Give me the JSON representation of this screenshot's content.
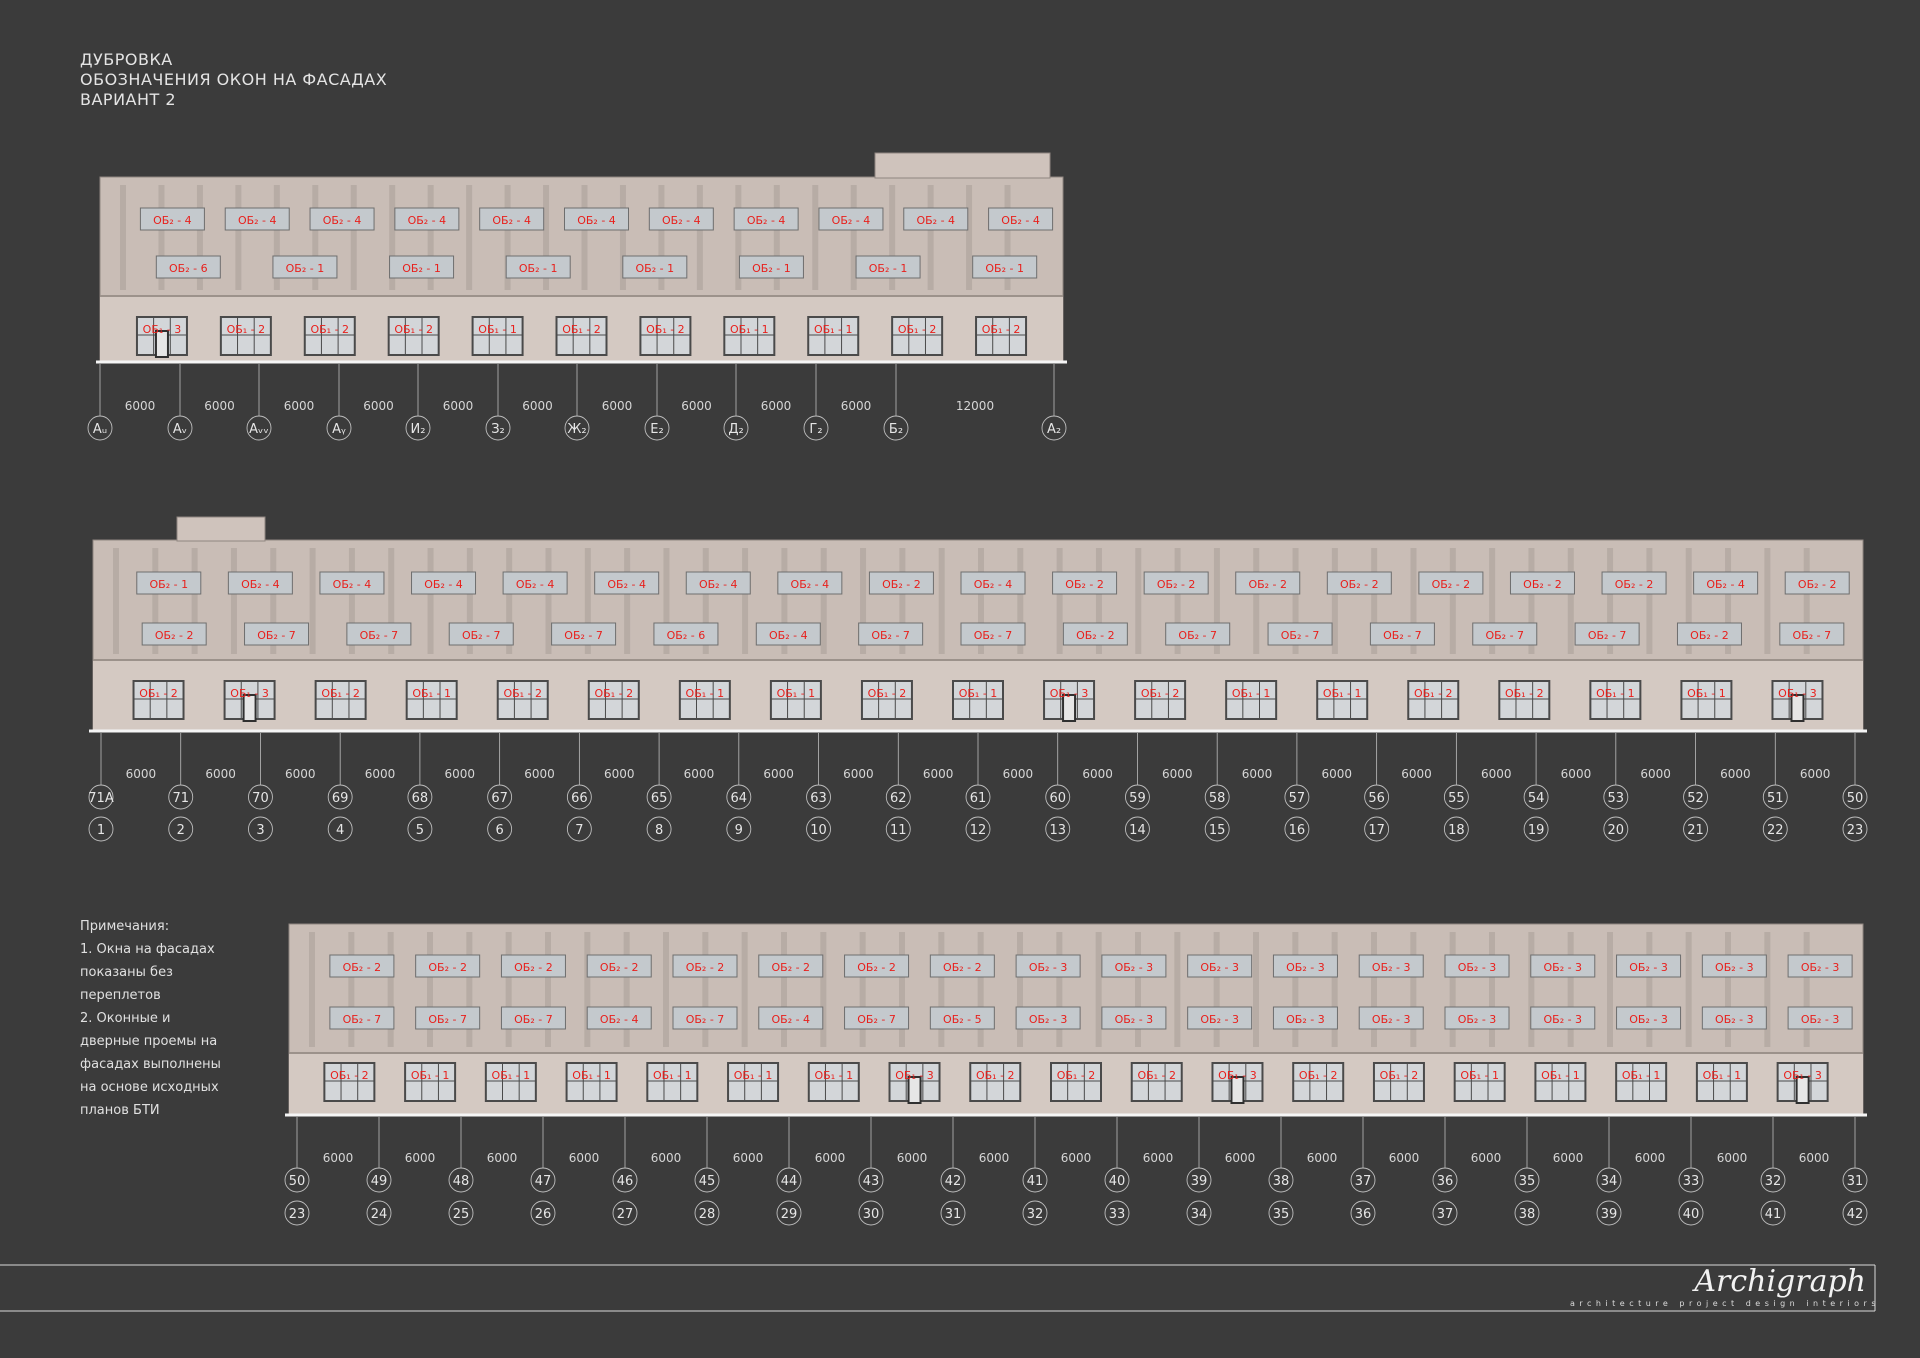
{
  "title": {
    "line1": "ДУБРОВКА",
    "line2": "ОБОЗНАЧЕНИЯ ОКОН НА ФАСАДАХ",
    "line3": "ВАРИАНТ 2"
  },
  "notes": {
    "heading": "Примечания:",
    "lines": [
      "1. Окна на фасадах",
      "показаны без",
      "переплетов",
      "2. Оконные и",
      "дверные проемы на",
      "фасадах выполнены",
      "на основе исходных",
      "планов БТИ"
    ]
  },
  "brand": {
    "signature": "Archigraph",
    "tagline": "architecture project design interiors"
  },
  "colors": {
    "background": "#3b3b3b",
    "facade": "#c9bdb6",
    "window": "#c4c9cd",
    "label": "#e8201c",
    "axis": "#bdbdbd"
  },
  "facades": [
    {
      "name": "facade-1",
      "dims": [
        "6000",
        "6000",
        "6000",
        "6000",
        "6000",
        "6000",
        "6000",
        "6000",
        "6000",
        "6000",
        "12000"
      ],
      "axes": [
        "Аᵤ",
        "Аᵥ",
        "Аᵥᵥ",
        "Аᵧ",
        "И₂",
        "З₂",
        "Ж₂",
        "Е₂",
        "Д₂",
        "Г₂",
        "Б₂",
        "А₂"
      ],
      "axes2": [],
      "row1": [
        "ОБ₂ - 4",
        "ОБ₂ - 4",
        "ОБ₂ - 4",
        "ОБ₂ - 4",
        "ОБ₂ - 4",
        "ОБ₂ - 4",
        "ОБ₂ - 4",
        "ОБ₂ - 4",
        "ОБ₂ - 4",
        "ОБ₂ - 4",
        "ОБ₂ - 4"
      ],
      "row2": [
        "ОБ₂ - 6",
        "ОБ₂ - 1",
        "ОБ₂ - 1",
        "ОБ₂ - 1",
        "ОБ₂ - 1",
        "ОБ₂ - 1",
        "ОБ₂ - 1",
        "ОБ₂ - 1"
      ],
      "ground": [
        "ОБ₁ - 3",
        "ОБ₁ - 2",
        "ОБ₁ - 2",
        "ОБ₁ - 2",
        "ОБ₁ - 1",
        "ОБ₁ - 2",
        "ОБ₁ - 2",
        "ОБ₁ - 1",
        "ОБ₁ - 1",
        "ОБ₁ - 2",
        "ОБ₁ - 2"
      ]
    },
    {
      "name": "facade-2",
      "dims": [
        "6000",
        "6000",
        "6000",
        "6000",
        "6000",
        "6000",
        "6000",
        "6000",
        "6000",
        "6000",
        "6000",
        "6000",
        "6000",
        "6000",
        "6000",
        "6000",
        "6000",
        "6000",
        "6000",
        "6000",
        "6000",
        "6000"
      ],
      "axes": [
        "71А",
        "71",
        "70",
        "69",
        "68",
        "67",
        "66",
        "65",
        "64",
        "63",
        "62",
        "61",
        "60",
        "59",
        "58",
        "57",
        "56",
        "55",
        "54",
        "53",
        "52",
        "51",
        "50"
      ],
      "axes2": [
        "1",
        "2",
        "3",
        "4",
        "5",
        "6",
        "7",
        "8",
        "9",
        "10",
        "11",
        "12",
        "13",
        "14",
        "15",
        "16",
        "17",
        "18",
        "19",
        "20",
        "21",
        "22",
        "23"
      ],
      "row1": [
        "ОБ₂ - 1",
        "ОБ₂ - 4",
        "ОБ₂ - 4",
        "ОБ₂ - 4",
        "ОБ₂ - 4",
        "ОБ₂ - 4",
        "ОБ₂ - 4",
        "ОБ₂ - 4",
        "ОБ₂ - 2",
        "ОБ₂ - 4",
        "ОБ₂ - 2",
        "ОБ₂ - 2",
        "ОБ₂ - 2",
        "ОБ₂ - 2",
        "ОБ₂ - 2",
        "ОБ₂ - 2",
        "ОБ₂ - 2",
        "ОБ₂ - 4",
        "ОБ₂ - 2"
      ],
      "row2": [
        "ОБ₂ - 2",
        "ОБ₂ - 7",
        "ОБ₂ - 7",
        "ОБ₂ - 7",
        "ОБ₂ - 7",
        "ОБ₂ - 6",
        "ОБ₂ - 4",
        "ОБ₂ - 7",
        "ОБ₂ - 7",
        "ОБ₂ - 2",
        "ОБ₂ - 7",
        "ОБ₂ - 7",
        "ОБ₂ - 7",
        "ОБ₂ - 7",
        "ОБ₂ - 7",
        "ОБ₂ - 2",
        "ОБ₂ - 7"
      ],
      "ground": [
        "ОБ₁ - 2",
        "ОБ₁ - 3",
        "ОБ₁ - 2",
        "ОБ₁ - 1",
        "ОБ₁ - 2",
        "ОБ₁ - 2",
        "ОБ₁ - 1",
        "ОБ₁ - 1",
        "ОБ₁ - 2",
        "ОБ₁ - 1",
        "ОБ₁ - 3",
        "ОБ₁ - 2",
        "ОБ₁ - 1",
        "ОБ₁ - 1",
        "ОБ₁ - 2",
        "ОБ₁ - 2",
        "ОБ₁ - 1",
        "ОБ₁ - 1",
        "ОБ₁ - 3"
      ]
    },
    {
      "name": "facade-3",
      "dims": [
        "6000",
        "6000",
        "6000",
        "6000",
        "6000",
        "6000",
        "6000",
        "6000",
        "6000",
        "6000",
        "6000",
        "6000",
        "6000",
        "6000",
        "6000",
        "6000",
        "6000",
        "6000",
        "6000"
      ],
      "axes": [
        "50",
        "49",
        "48",
        "47",
        "46",
        "45",
        "44",
        "43",
        "42",
        "41",
        "40",
        "39",
        "38",
        "37",
        "36",
        "35",
        "34",
        "33",
        "32",
        "31"
      ],
      "axes2": [
        "23",
        "24",
        "25",
        "26",
        "27",
        "28",
        "29",
        "30",
        "31",
        "32",
        "33",
        "34",
        "35",
        "36",
        "37",
        "38",
        "39",
        "40",
        "41",
        "42"
      ],
      "row1": [
        "ОБ₂ - 2",
        "ОБ₂ - 2",
        "ОБ₂ - 2",
        "ОБ₂ - 2",
        "ОБ₂ - 2",
        "ОБ₂ - 2",
        "ОБ₂ - 2",
        "ОБ₂ - 2",
        "ОБ₂ - 3",
        "ОБ₂ - 3",
        "ОБ₂ - 3",
        "ОБ₂ - 3",
        "ОБ₂ - 3",
        "ОБ₂ - 3",
        "ОБ₂ - 3",
        "ОБ₂ - 3",
        "ОБ₂ - 3",
        "ОБ₂ - 3"
      ],
      "row2": [
        "ОБ₂ - 7",
        "ОБ₂ - 7",
        "ОБ₂ - 7",
        "ОБ₂ - 4",
        "ОБ₂ - 7",
        "ОБ₂ - 4",
        "ОБ₂ - 7",
        "ОБ₂ - 5",
        "ОБ₂ - 3",
        "ОБ₂ - 3",
        "ОБ₂ - 3",
        "ОБ₂ - 3",
        "ОБ₂ - 3",
        "ОБ₂ - 3",
        "ОБ₂ - 3",
        "ОБ₂ - 3",
        "ОБ₂ - 3",
        "ОБ₂ - 3"
      ],
      "ground": [
        "ОБ₁ - 2",
        "ОБ₁ - 1",
        "ОБ₁ - 1",
        "ОБ₁ - 1",
        "ОБ₁ - 1",
        "ОБ₁ - 1",
        "ОБ₁ - 1",
        "ОБ₁ - 3",
        "ОБ₁ - 2",
        "ОБ₁ - 2",
        "ОБ₁ - 2",
        "ОБ₁ - 3",
        "ОБ₁ - 2",
        "ОБ₁ - 2",
        "ОБ₁ - 1",
        "ОБ₁ - 1",
        "ОБ₁ - 1",
        "ОБ₁ - 1",
        "ОБ₁ - 3"
      ]
    }
  ]
}
